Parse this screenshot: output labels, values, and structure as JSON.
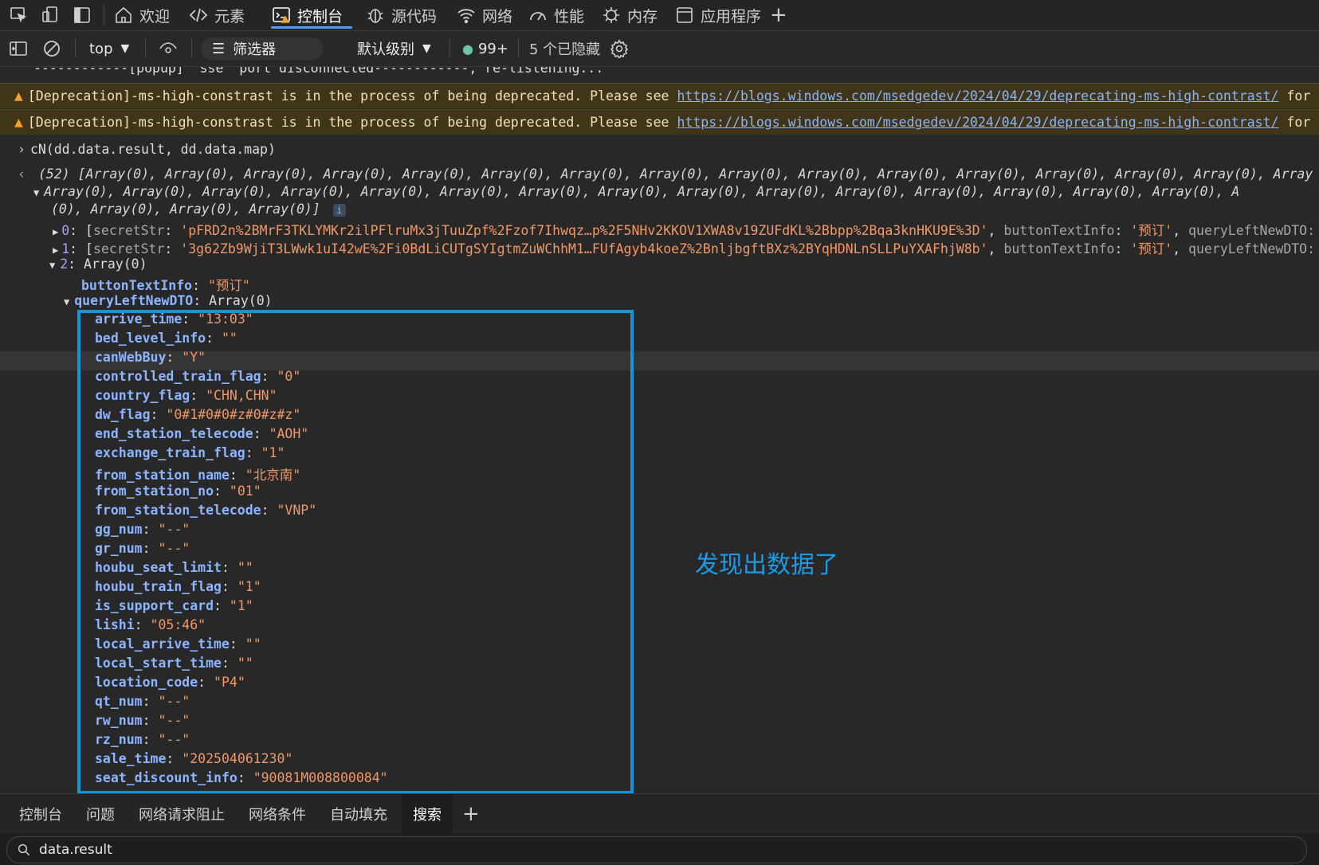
{
  "tabs": [
    {
      "label": "欢迎"
    },
    {
      "label": "元素"
    },
    {
      "label": "控制台"
    },
    {
      "label": "源代码"
    },
    {
      "label": "网络"
    },
    {
      "label": "性能"
    },
    {
      "label": "内存"
    },
    {
      "label": "应用程序"
    }
  ],
  "toolbar": {
    "context": "top",
    "filter_label": "筛选器",
    "level": "默认级别",
    "issues": "99+",
    "hidden": "5 个已隐藏"
  },
  "console": {
    "popup_line": "------------[popup] `sse` port disconnected------------, re-listening...",
    "warning_text": "[Deprecation]-ms-high-constrast is in the process of being deprecated. Please see",
    "warning_link": "https://blogs.windows.com/msedgedev/2024/04/29/deprecating-ms-high-contrast/",
    "warning_tail": "for",
    "command": "cN(dd.data.result, dd.data.map)",
    "result_count": "(52)",
    "result_line1": "[Array(0), Array(0), Array(0), Array(0), Array(0), Array(0), Array(0), Array(0), Array(0), Array(0), Array(0), Array(0), Array(0), Array(0), Array(0), Array",
    "result_line2": "Array(0), Array(0), Array(0), Array(0), Array(0), Array(0), Array(0), Array(0), Array(0), Array(0), Array(0), Array(0), Array(0), Array(0), Array(0), A",
    "result_line3": "(0), Array(0), Array(0), Array(0)]",
    "item0_key": "0",
    "item0_secret": "'pFRD2n%2BMrF3TKLYMKr2ilPFlruMx3jTuuZpf%2Fzof7Ihwqz…p%2F5NHv2KKOV1XWA8v19ZUFdKL%2Bbpp%2Bqa3knHKU9E%3D'",
    "item1_key": "1",
    "item1_secret": "'3g62Zb9WjiT3LWwk1uI42wE%2Fi0BdLiCUTgSYIgtmZuWChhM1…FUfAgyb4koeZ%2BnljbgftBXz%2BYqHDNLnSLLPuYXAFhjW8b'",
    "button_text_value": "'预订'",
    "item2_key": "2",
    "array_label": "Array(0)",
    "button_text_info_key": "buttonTextInfo",
    "button_text_info_val": "\"预订\"",
    "query_key": "queryLeftNewDTO",
    "secret_key": "secretStr",
    "query_key_tail": "queryLeftNewDTO:"
  },
  "properties": [
    {
      "key": "arrive_time",
      "value": "\"13:03\""
    },
    {
      "key": "bed_level_info",
      "value": "\"\""
    },
    {
      "key": "canWebBuy",
      "value": "\"Y\""
    },
    {
      "key": "controlled_train_flag",
      "value": "\"0\""
    },
    {
      "key": "country_flag",
      "value": "\"CHN,CHN\""
    },
    {
      "key": "dw_flag",
      "value": "\"0#1#0#0#z#0#z#z\""
    },
    {
      "key": "end_station_telecode",
      "value": "\"AOH\""
    },
    {
      "key": "exchange_train_flag",
      "value": "\"1\""
    },
    {
      "key": "from_station_name",
      "value": "\"北京南\""
    },
    {
      "key": "from_station_no",
      "value": "\"01\""
    },
    {
      "key": "from_station_telecode",
      "value": "\"VNP\""
    },
    {
      "key": "gg_num",
      "value": "\"--\""
    },
    {
      "key": "gr_num",
      "value": "\"--\""
    },
    {
      "key": "houbu_seat_limit",
      "value": "\"\""
    },
    {
      "key": "houbu_train_flag",
      "value": "\"1\""
    },
    {
      "key": "is_support_card",
      "value": "\"1\""
    },
    {
      "key": "lishi",
      "value": "\"05:46\""
    },
    {
      "key": "local_arrive_time",
      "value": "\"\""
    },
    {
      "key": "local_start_time",
      "value": "\"\""
    },
    {
      "key": "location_code",
      "value": "\"P4\""
    },
    {
      "key": "qt_num",
      "value": "\"--\""
    },
    {
      "key": "rw_num",
      "value": "\"--\""
    },
    {
      "key": "rz_num",
      "value": "\"--\""
    },
    {
      "key": "sale_time",
      "value": "\"202504061230\""
    },
    {
      "key": "seat_discount_info",
      "value": "\"90081M008800084\""
    }
  ],
  "annotation": "发现出数据了",
  "drawer_tabs": [
    {
      "label": "控制台"
    },
    {
      "label": "问题"
    },
    {
      "label": "网络请求阻止"
    },
    {
      "label": "网络条件"
    },
    {
      "label": "自动填充"
    },
    {
      "label": "搜索"
    }
  ],
  "search": {
    "value": "data.result"
  },
  "colors": {
    "accent": "#1296db",
    "warning_bg": "#413519",
    "string": "#f29766",
    "key": "#8cb4ff"
  }
}
